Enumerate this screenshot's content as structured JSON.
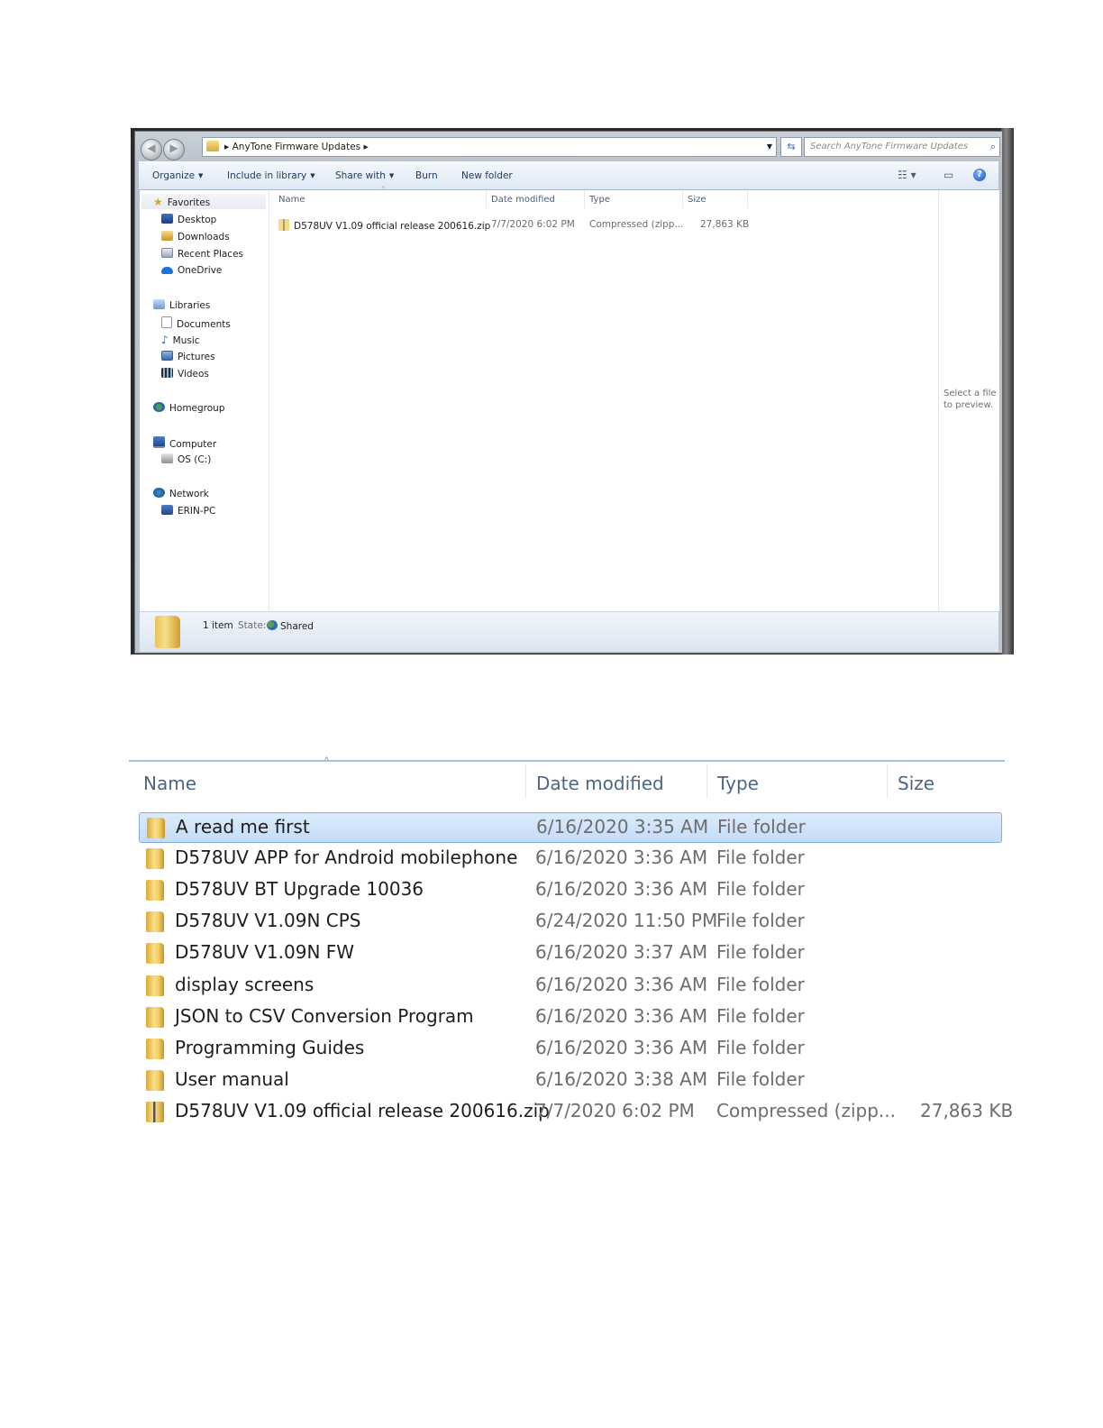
{
  "explorer": {
    "breadcrumb": "AnyTone Firmware Updates",
    "search_placeholder": "Search AnyTone Firmware Updates",
    "toolbar": {
      "organize": "Organize",
      "include_in_library": "Include in library",
      "share_with": "Share with",
      "burn": "Burn",
      "new_folder": "New folder"
    },
    "nav": {
      "favorites": "Favorites",
      "desktop": "Desktop",
      "downloads": "Downloads",
      "recent_places": "Recent Places",
      "onedrive": "OneDrive",
      "libraries": "Libraries",
      "documents": "Documents",
      "music": "Music",
      "pictures": "Pictures",
      "videos": "Videos",
      "homegroup": "Homegroup",
      "computer": "Computer",
      "os_drive": "OS (C:)",
      "network": "Network",
      "erin_pc": "ERIN-PC"
    },
    "columns": {
      "name": "Name",
      "date": "Date modified",
      "type": "Type",
      "size": "Size"
    },
    "file": {
      "name": "D578UV V1.09 official release 200616.zip",
      "date": "7/7/2020 6:02 PM",
      "type": "Compressed (zipp...",
      "size": "27,863 KB"
    },
    "preview_text": "Select a file to preview.",
    "status": {
      "count": "1 item",
      "state_label": "State:",
      "state_value": "Shared"
    }
  },
  "list": {
    "columns": {
      "name": "Name",
      "date": "Date modified",
      "type": "Type",
      "size": "Size"
    },
    "rows": [
      {
        "name": "A read me first",
        "date": "6/16/2020 3:35 AM",
        "type": "File folder",
        "size": ""
      },
      {
        "name": "D578UV APP for Android mobilephone",
        "date": "6/16/2020 3:36 AM",
        "type": "File folder",
        "size": ""
      },
      {
        "name": "D578UV BT Upgrade 10036",
        "date": "6/16/2020 3:36 AM",
        "type": "File folder",
        "size": ""
      },
      {
        "name": "D578UV V1.09N CPS",
        "date": "6/24/2020 11:50 PM",
        "type": "File folder",
        "size": ""
      },
      {
        "name": "D578UV V1.09N FW",
        "date": "6/16/2020 3:37 AM",
        "type": "File folder",
        "size": ""
      },
      {
        "name": "display screens",
        "date": "6/16/2020 3:36 AM",
        "type": "File folder",
        "size": ""
      },
      {
        "name": "JSON to CSV Conversion Program",
        "date": "6/16/2020 3:36 AM",
        "type": "File folder",
        "size": ""
      },
      {
        "name": "Programming Guides",
        "date": "6/16/2020 3:36 AM",
        "type": "File folder",
        "size": ""
      },
      {
        "name": "User manual",
        "date": "6/16/2020 3:38 AM",
        "type": "File folder",
        "size": ""
      },
      {
        "name": "D578UV V1.09 official release 200616.zip",
        "date": "7/7/2020 6:02 PM",
        "type": "Compressed (zipp...",
        "size": "27,863 KB"
      }
    ]
  }
}
